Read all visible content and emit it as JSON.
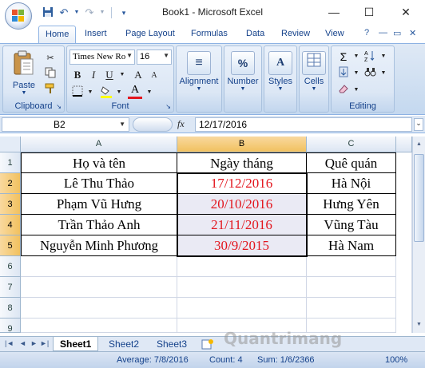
{
  "window": {
    "title": "Book1 - Microsoft Excel",
    "minimize_glyph": "—",
    "maximize_glyph": "☐",
    "close_glyph": "✕"
  },
  "tabs": [
    {
      "label": "Home",
      "active": true
    },
    {
      "label": "Insert"
    },
    {
      "label": "Page Layout"
    },
    {
      "label": "Formulas"
    },
    {
      "label": "Data"
    },
    {
      "label": "Review"
    },
    {
      "label": "View"
    }
  ],
  "ribbon": {
    "clipboard": {
      "group_label": "Clipboard",
      "paste_label": "Paste"
    },
    "font": {
      "group_label": "Font",
      "font_name": "Times New Ro",
      "font_size": "16",
      "bold": "B",
      "italic": "I",
      "underline": "U",
      "grow": "A",
      "shrink": "A",
      "font_color_glyph": "A"
    },
    "alignment_label": "Alignment",
    "number_label": "Number",
    "number_glyph": "%",
    "styles_label": "Styles",
    "styles_glyph": "A",
    "cells_label": "Cells",
    "editing_label": "Editing",
    "sum_glyph": "Σ"
  },
  "formula_bar": {
    "name_box": "B2",
    "fx_label": "fx",
    "formula": "12/17/2016"
  },
  "grid": {
    "columns": [
      "A",
      "B",
      "C"
    ],
    "rows": [
      "1",
      "2",
      "3",
      "4",
      "5",
      "6",
      "7",
      "8",
      "9"
    ],
    "cells": [
      [
        "Họ và tên",
        "Ngày tháng",
        "Quê quán"
      ],
      [
        "Lê Thu Thảo",
        "17/12/2016",
        "Hà Nội"
      ],
      [
        "Phạm Vũ Hưng",
        "20/10/2016",
        "Hưng Yên"
      ],
      [
        "Trần Thảo Anh",
        "21/11/2016",
        "Vũng Tàu"
      ],
      [
        "Nguyễn Minh Phương",
        "30/9/2015",
        "Hà Nam"
      ]
    ],
    "date_color": "#e3161e"
  },
  "sheets": [
    {
      "label": "Sheet1",
      "active": true
    },
    {
      "label": "Sheet2"
    },
    {
      "label": "Sheet3"
    }
  ],
  "status": {
    "average": "Average: 7/8/2016",
    "count": "Count: 4",
    "sum": "Sum: 1/6/2366",
    "zoom": "100%"
  },
  "watermark": "Quantrimang"
}
